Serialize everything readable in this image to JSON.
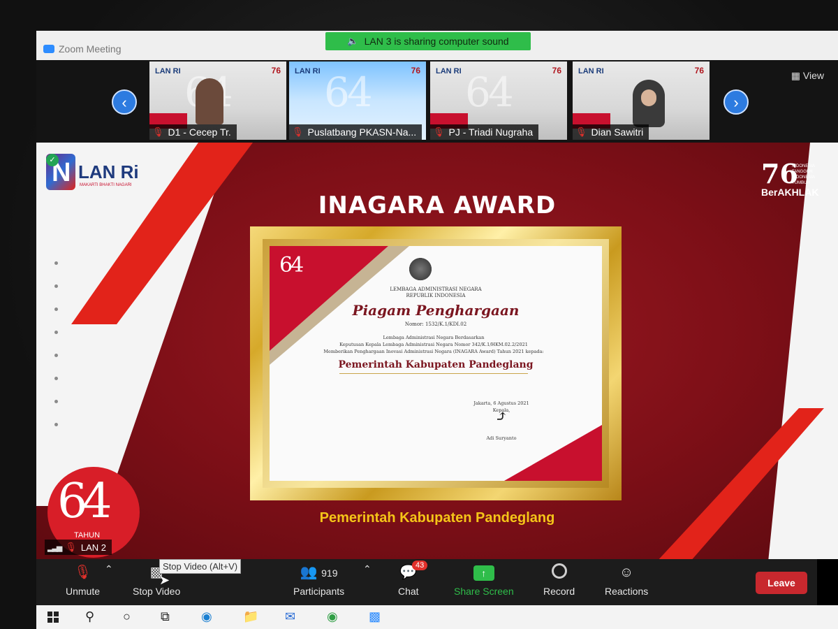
{
  "window": {
    "title": "Zoom Meeting"
  },
  "banner": {
    "text": "LAN 3 is sharing computer sound"
  },
  "view_label": "View",
  "participants_strip": [
    {
      "name": "D1 - Cecep Tr.",
      "muted": true
    },
    {
      "name": "Puslatbang PKASN-Na...",
      "muted": true
    },
    {
      "name": "PJ - Triadi Nugraha",
      "muted": true
    },
    {
      "name": "Dian Sawitri",
      "muted": true
    }
  ],
  "thumb": {
    "lan": "LAN RI",
    "seventy_six": "76"
  },
  "slide": {
    "logo_text": "LAN Ri",
    "logo_sub": "MAKARTI BHAKTI NAGARI",
    "title": "INAGARA AWARD",
    "right_logo": {
      "num": "76",
      "tag": "INDONESIA TANGGUH INDONESIA TUMBUH",
      "ber": "BerAKHLAK"
    },
    "caption": "Pemerintah Kabupaten Pandeglang",
    "badge_num": "64",
    "badge_tahun": "TAHUN"
  },
  "certificate": {
    "seal": "64",
    "org_line1": "LEMBAGA ADMINISTRASI NEGARA",
    "org_line2": "REPUBLIK INDONESIA",
    "heading": "Piagam Penghargaan",
    "number": "Nomor: 1532/K.1/KDI.02",
    "body_line1": "Lembaga Administrasi Negara Berdasarkan",
    "body_line2": "Keputusan Kepala Lembaga Administrasi Negara Nomor 342/K.1/HKM.02.2/2021",
    "body_line3": "Memberikan Penghargaan Inovasi Administrasi Negara (INAGARA Award) Tahun 2021 kepada:",
    "recipient": "Pemerintah Kabupaten Pandeglang",
    "place_date": "Jakarta, 6 Agustus 2021",
    "role": "Kepala,",
    "signatory": "Adi Suryanto"
  },
  "self_view": {
    "name": "LAN 2"
  },
  "toolbar": {
    "unmute": "Unmute",
    "stop_video": "Stop Video",
    "tooltip": "Stop Video (Alt+V)",
    "participants": "Participants",
    "participants_count": "919",
    "chat": "Chat",
    "chat_badge": "43",
    "share": "Share Screen",
    "record": "Record",
    "reactions": "Reactions",
    "leave": "Leave"
  },
  "colors": {
    "slide_red": "#9b1922",
    "accent_green": "#2fbd4a",
    "leave_red": "#c8282e",
    "gold": "#f5c518"
  }
}
